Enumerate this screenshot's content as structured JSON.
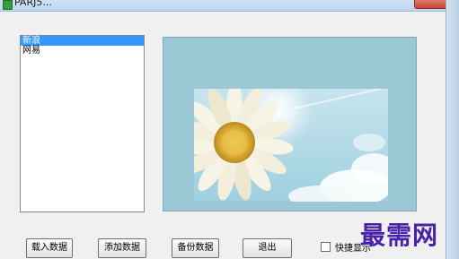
{
  "window": {
    "title": "PARJ5..."
  },
  "list": {
    "items": [
      {
        "label": "新浪",
        "selected": true
      },
      {
        "label": "网易",
        "selected": false
      }
    ]
  },
  "picture": {
    "description_icon": "daisy-photo"
  },
  "buttons": {
    "load": "载入数据",
    "add": "添加数据",
    "backup": "备份数据",
    "exit": "退出"
  },
  "checkbox": {
    "label": "快捷显示",
    "checked": false
  },
  "watermark": "最需网",
  "colors": {
    "selection": "#3399ff",
    "watermark": "#4a22a8"
  }
}
